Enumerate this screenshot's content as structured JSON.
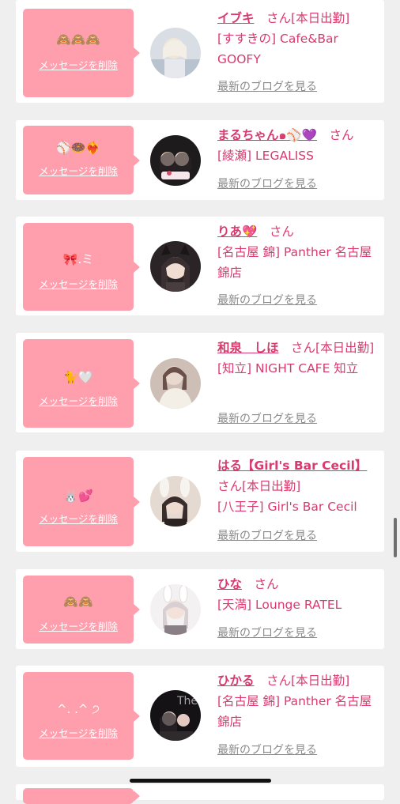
{
  "messages": [
    {
      "emoji": "🙈🙈🙈",
      "delete_label": "メッセージを削除",
      "name": "イブキ",
      "san": "さん",
      "status": "[本日出勤]",
      "shop": "[すすきの] Cafe&Bar GOOFY",
      "blog_label": "最新のブログを見る"
    },
    {
      "emoji": "⚾🍩❤‍🔥",
      "delete_label": "メッセージを削除",
      "name": "まるちゃん๑⚾💜",
      "san": "さん",
      "status": "",
      "shop": "[綾瀬] LEGALISS",
      "blog_label": "最新のブログを見る"
    },
    {
      "emoji": "🎀.ミ",
      "delete_label": "メッセージを削除",
      "name": "りあ💖",
      "san": "さん",
      "status": "",
      "shop": "[名古屋 錦] Panther 名古屋錦店",
      "blog_label": "最新のブログを見る"
    },
    {
      "emoji": "🐈🤍",
      "delete_label": "メッセージを削除",
      "name": "和泉　しほ",
      "san": "さん",
      "status": "[本日出勤]",
      "shop": "[知立] NIGHT CAFE 知立",
      "blog_label": "最新のブログを見る"
    },
    {
      "emoji": "🐰💕",
      "delete_label": "メッセージを削除",
      "name": "はる【Girl's Bar Cecil】",
      "san": "さん",
      "status": "[本日出勤]",
      "shop": "[八王子] Girl's Bar Cecil",
      "blog_label": "最新のブログを見る"
    },
    {
      "emoji": "🙈🙈",
      "delete_label": "メッセージを削除",
      "name": "ひな",
      "san": "さん",
      "status": "",
      "shop": "[天満] Lounge RATEL",
      "blog_label": "最新のブログを見る"
    },
    {
      "emoji": "^. .^ ੭",
      "delete_label": "メッセージを削除",
      "name": "ひかる",
      "san": "さん",
      "status": "[本日出勤]",
      "shop": "[名古屋 錦] Panther 名古屋錦店",
      "blog_label": "最新のブログを見る"
    }
  ],
  "colors": {
    "bubble": "#ff9fae",
    "accent": "#d93a6e",
    "link_gray": "#8a8a8a",
    "background": "#efefef"
  }
}
